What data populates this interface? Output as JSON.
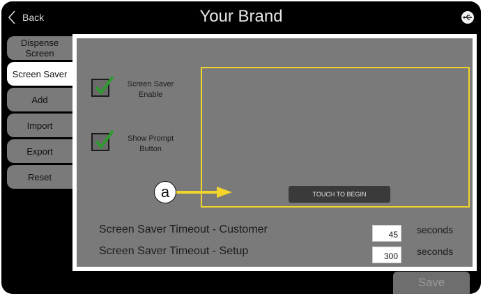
{
  "header": {
    "back_label": "Back",
    "title": "Your Brand",
    "usb_icon": "usb-icon"
  },
  "sidebar": {
    "tabs": [
      {
        "label": "Dispense Screen",
        "active": false
      },
      {
        "label": "Screen Saver",
        "active": true
      },
      {
        "label": "Add",
        "active": false
      },
      {
        "label": "Import",
        "active": false
      },
      {
        "label": "Export",
        "active": false
      },
      {
        "label": "Reset",
        "active": false
      }
    ]
  },
  "settings": {
    "screen_saver_enable": {
      "label": "Screen Saver Enable",
      "checked": true
    },
    "show_prompt_button": {
      "label": "Show Prompt Button",
      "checked": true
    }
  },
  "preview": {
    "touch_button_label": "TOUCH TO BEGIN",
    "highlight_color": "#f2d42a"
  },
  "annotation": {
    "callout_letter": "a",
    "arrow_color": "#f2d42a"
  },
  "timeouts": {
    "customer": {
      "label": "Screen Saver Timeout - Customer",
      "value": "45",
      "unit": "seconds"
    },
    "setup": {
      "label": "Screen Saver Timeout - Setup",
      "value": "300",
      "unit": "seconds"
    }
  },
  "footer": {
    "save_label": "Save"
  },
  "colors": {
    "check_green": "#2e9b2e",
    "panel_gray": "#7a7a7a",
    "background": "#000000"
  }
}
